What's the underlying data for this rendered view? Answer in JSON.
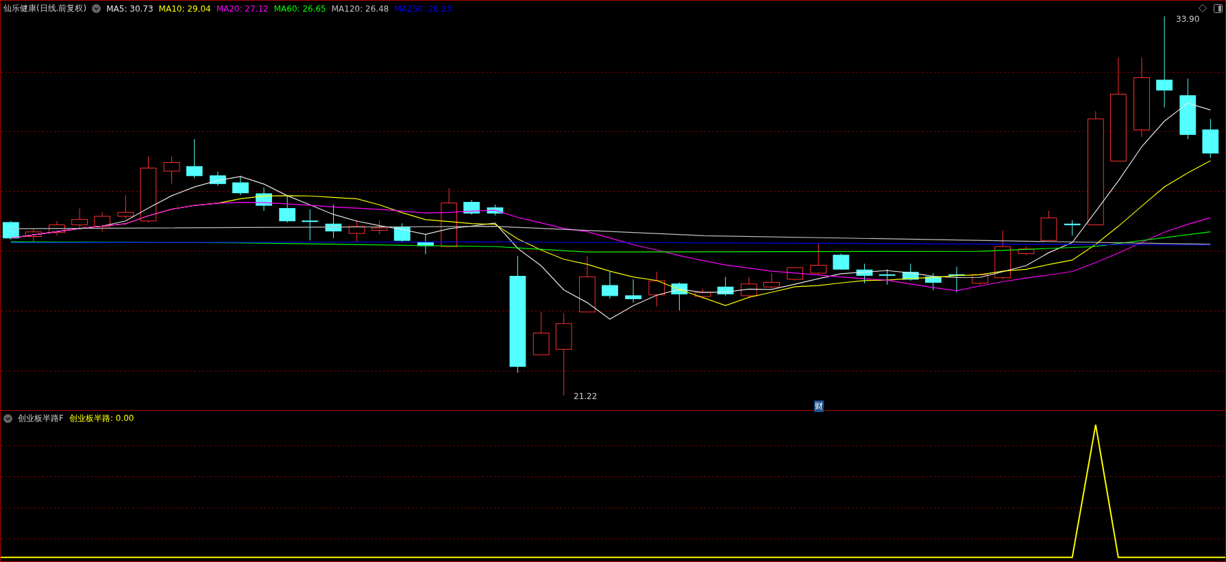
{
  "chart": {
    "title": "仙乐健康(日线.前复权)",
    "averages": [
      {
        "label": "MA5: 30.73",
        "color": "#e6e6e6"
      },
      {
        "label": "MA10: 29.04",
        "color": "#ffff00"
      },
      {
        "label": "MA20: 27.12",
        "color": "#ff00ff"
      },
      {
        "label": "MA60: 26.65",
        "color": "#00ff00"
      },
      {
        "label": "MA120: 26.48",
        "color": "#c0c0c0"
      },
      {
        "label": "MA250: 26.23",
        "color": "#0000ff"
      }
    ],
    "high_label": "33.90",
    "low_label": "21.22",
    "event_marker": "财"
  },
  "indicator": {
    "title": "创业板半路F",
    "legend": "创业板半路: 0.00"
  }
}
